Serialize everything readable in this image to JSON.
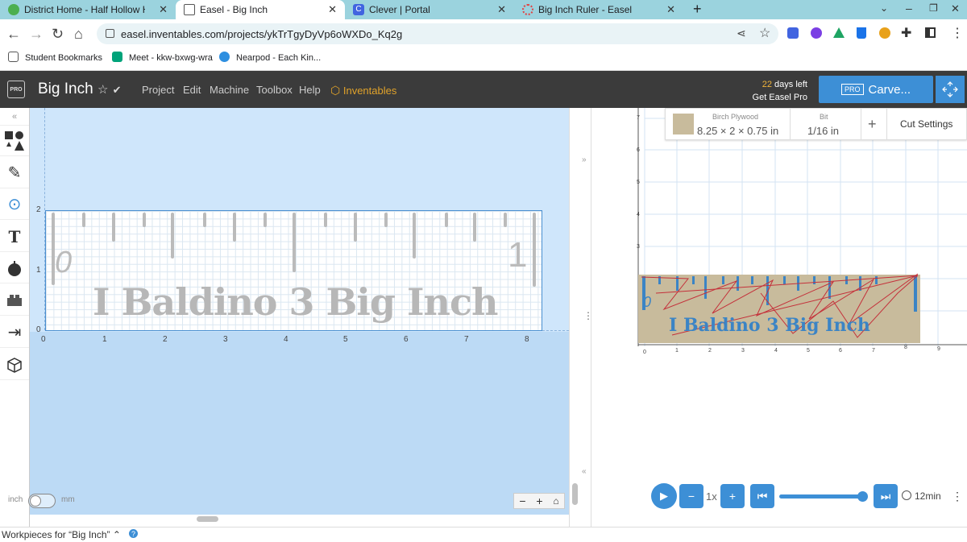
{
  "browser": {
    "tabs": [
      {
        "title": "District Home - Half Hollow Hills",
        "favicon_color": "#4caf50",
        "active": false
      },
      {
        "title": "Easel - Big Inch",
        "favicon_color": "#555555",
        "active": true
      },
      {
        "title": "Clever | Portal",
        "favicon_color": "#4164e0",
        "active": false
      },
      {
        "title": "Big Inch Ruler - Easel",
        "favicon_color": "#e04444",
        "active": false
      }
    ],
    "new_tab": "+",
    "url": "easel.inventables.com/projects/ykTrTgyDyVp6oWXDo_Kq2g",
    "bookmarks": [
      {
        "label": "Student Bookmarks",
        "icon_color": "#555555"
      },
      {
        "label": "Meet - kkw-bxwg-wra",
        "icon_color": "#00a37a"
      },
      {
        "label": "Nearpod - Each Kin...",
        "icon_color": "#2e8fe0"
      }
    ]
  },
  "app": {
    "logo": "PRO",
    "project_title": "Big Inch",
    "star_glyph": "☆",
    "check_glyph": "✔",
    "menu": [
      "Project",
      "Edit",
      "Machine",
      "Toolbox",
      "Help"
    ],
    "inventables_label": "Inventables",
    "trial_days": "22",
    "trial_suffix": " days left",
    "trial_cta": "Get Easel Pro",
    "carve_pro_badge": "PRO",
    "carve_label": "Carve...",
    "accent": "#3d8fd6",
    "header_bg": "#3b3b3b"
  },
  "design": {
    "text": "I Baldino 3 Big Inch",
    "zero_glyph": "0",
    "one_glyph": "1",
    "x_ticks": [
      "0",
      "1",
      "2",
      "3",
      "4",
      "5",
      "6",
      "7",
      "8"
    ],
    "y_ticks": [
      "2",
      "1",
      "0"
    ],
    "unit_left": "inch",
    "unit_right": "mm",
    "zoom_minus": "−",
    "zoom_plus": "+",
    "home_glyph": "⌂"
  },
  "preview": {
    "material_label": "Birch Plywood",
    "material_dims": "8.25 × 2 × 0.75 in",
    "bit_label": "Bit",
    "bit_value": "1/16 in",
    "add_glyph": "+",
    "cut_settings": "Cut Settings",
    "text": "I Baldino 3 Big Inch",
    "zero_glyph": "0",
    "x_ticks": [
      "0",
      "1",
      "2",
      "3",
      "4",
      "5",
      "6",
      "7",
      "8",
      "9"
    ],
    "y_ticks": [
      "7",
      "6",
      "5",
      "4",
      "3"
    ],
    "speed": "1x",
    "duration": "12min",
    "progress": 1.0
  },
  "status": {
    "workpieces": "Workpieces for “Big Inch” ⌃"
  }
}
